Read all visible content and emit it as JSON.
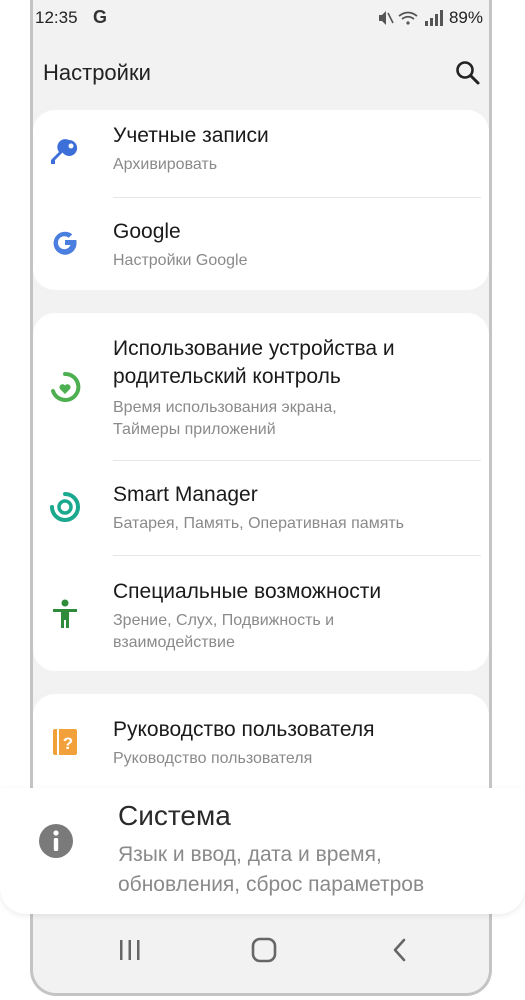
{
  "status": {
    "time": "12:35",
    "g_letter": "G",
    "battery": "89%"
  },
  "appbar": {
    "title": "Настройки",
    "search_icon": "search-icon"
  },
  "sections": [
    {
      "items": [
        {
          "icon": "key-icon",
          "title": "Учетные записи",
          "subtitle": "Архивировать"
        },
        {
          "icon": "google-icon",
          "title": "Google",
          "subtitle": "Настройки Google"
        }
      ]
    },
    {
      "items": [
        {
          "icon": "digital-wellbeing-icon",
          "title_lines": [
            "Использование устройства и",
            "родительский контроль"
          ],
          "subtitle_lines": [
            "Время использования экрана,",
            "Таймеры приложений"
          ]
        },
        {
          "icon": "smart-manager-icon",
          "title": "Smart Manager",
          "subtitle": "Батарея, Память, Оперативная память"
        },
        {
          "icon": "accessibility-icon",
          "title": "Специальные возможности",
          "subtitle_lines": [
            "Зрение, Слух, Подвижность и",
            "взаимодействие"
          ]
        }
      ]
    },
    {
      "items": [
        {
          "icon": "user-manual-icon",
          "title": "Руководство пользователя",
          "subtitle": "Руководство пользователя"
        }
      ]
    }
  ],
  "overlay": {
    "icon": "info-icon",
    "title": "Система",
    "subtitle_lines": [
      "Язык и ввод, дата и время,",
      "обновления, сброс параметров"
    ]
  },
  "navbar": {
    "recent_icon": "recent-apps-icon",
    "home_icon": "home-icon",
    "back_icon": "back-icon"
  },
  "colors": {
    "key": "#3d6fd8",
    "wellbeing": "#4caf50",
    "smart_manager": "#1aa88f",
    "accessibility": "#2e8b3a",
    "manual": "#f2a13a",
    "info": "#7a7a7a"
  }
}
